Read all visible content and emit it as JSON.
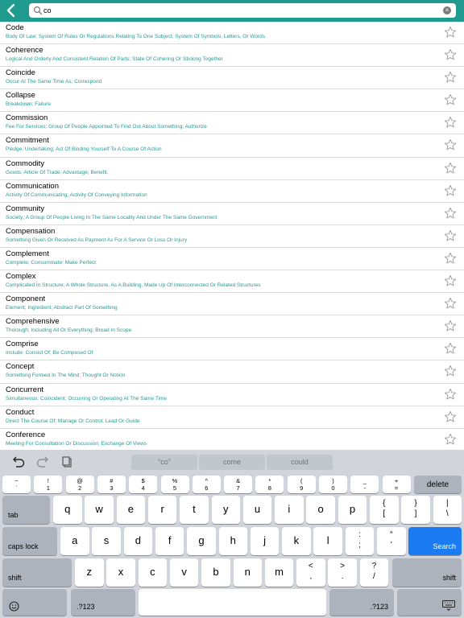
{
  "search": {
    "query": "co",
    "placeholder": ""
  },
  "entries": [
    {
      "word": "Code",
      "definition": "Body Of Law; System Of Rules Or Regulations Relating To One Subject; System Of Symbols, Letters, Or Words"
    },
    {
      "word": "Coherence",
      "definition": "Logical And Orderly And Consistent Relation Of Parts; State Of Cohering Or Sticking Together"
    },
    {
      "word": "Coincide",
      "definition": "Occur At The Same Time As; Correspond"
    },
    {
      "word": "Collapse",
      "definition": "Breakdown; Failure"
    },
    {
      "word": "Commission",
      "definition": "Fee For Services; Group Of People Appointed To Find Out About Something; Authorize"
    },
    {
      "word": "Commitment",
      "definition": "Pledge, Undertaking; Act Of Binding Yourself To A Course Of Action"
    },
    {
      "word": "Commodity",
      "definition": "Goods; Article Of Trade; Advantage; Benefit."
    },
    {
      "word": "Communication",
      "definition": "Activity Of Communicating; Activity Of Conveying Information"
    },
    {
      "word": "Community",
      "definition": "Society; A Group Of People Living In The Same Locality And Under The Same Government"
    },
    {
      "word": "Compensation",
      "definition": "Something Given Or Received As Payment As For A Service Or Loss Or Injury"
    },
    {
      "word": "Complement",
      "definition": "Complete; Consummate; Make Perfect"
    },
    {
      "word": "Complex",
      "definition": "Complicated In Structure; A Whole Structure, As A Building, Made Up Of Interconnected Or Related Structures"
    },
    {
      "word": "Component",
      "definition": "Element; Ingredient; Abstract Part Of Something"
    },
    {
      "word": "Comprehensive",
      "definition": "Thorough; Including All Or Everything; Broad In Scope"
    },
    {
      "word": "Comprise",
      "definition": "Include; Consist Of; Be Composed Of"
    },
    {
      "word": "Concept",
      "definition": "Something Formed In The Mind; Thought Or Notion"
    },
    {
      "word": "Concurrent",
      "definition": "Simultaneous; Coincident; Occurring Or Operating At The Same Time"
    },
    {
      "word": "Conduct",
      "definition": "Direct The Course Of; Manage Or Control; Lead Or Guide"
    },
    {
      "word": "Conference",
      "definition": "Meeting For Consultation Or Discussion; Exchange Of Views"
    }
  ],
  "keyboard": {
    "suggestions": [
      "“co”",
      "come",
      "could"
    ],
    "number_row": [
      {
        "top": "~",
        "bot": "`"
      },
      {
        "top": "!",
        "bot": "1"
      },
      {
        "top": "@",
        "bot": "2"
      },
      {
        "top": "#",
        "bot": "3"
      },
      {
        "top": "$",
        "bot": "4"
      },
      {
        "top": "%",
        "bot": "5"
      },
      {
        "top": "^",
        "bot": "6"
      },
      {
        "top": "&",
        "bot": "7"
      },
      {
        "top": "*",
        "bot": "8"
      },
      {
        "top": "(",
        "bot": "9"
      },
      {
        "top": ")",
        "bot": "0"
      },
      {
        "top": "_",
        "bot": "-"
      },
      {
        "top": "+",
        "bot": "="
      }
    ],
    "delete": "delete",
    "tab": "tab",
    "row_q": [
      "q",
      "w",
      "e",
      "r",
      "t",
      "y",
      "u",
      "i",
      "o",
      "p"
    ],
    "row_q_sym": [
      {
        "top": "{",
        "bot": "["
      },
      {
        "top": "}",
        "bot": "]"
      },
      {
        "top": "|",
        "bot": "\\"
      }
    ],
    "caps_lock": "caps lock",
    "row_a": [
      "a",
      "s",
      "d",
      "f",
      "g",
      "h",
      "j",
      "k",
      "l"
    ],
    "row_a_sym": [
      {
        "top": ":",
        "bot": ";"
      },
      {
        "top": "“",
        "bot": "’"
      }
    ],
    "search": "Search",
    "shift": "shift",
    "row_z": [
      "z",
      "x",
      "c",
      "v",
      "b",
      "n",
      "m"
    ],
    "row_z_sym": [
      {
        "top": "<",
        "bot": ","
      },
      {
        "top": ">",
        "bot": "."
      },
      {
        "top": "?",
        "bot": "/"
      }
    ],
    "num_mode": ".?123"
  }
}
